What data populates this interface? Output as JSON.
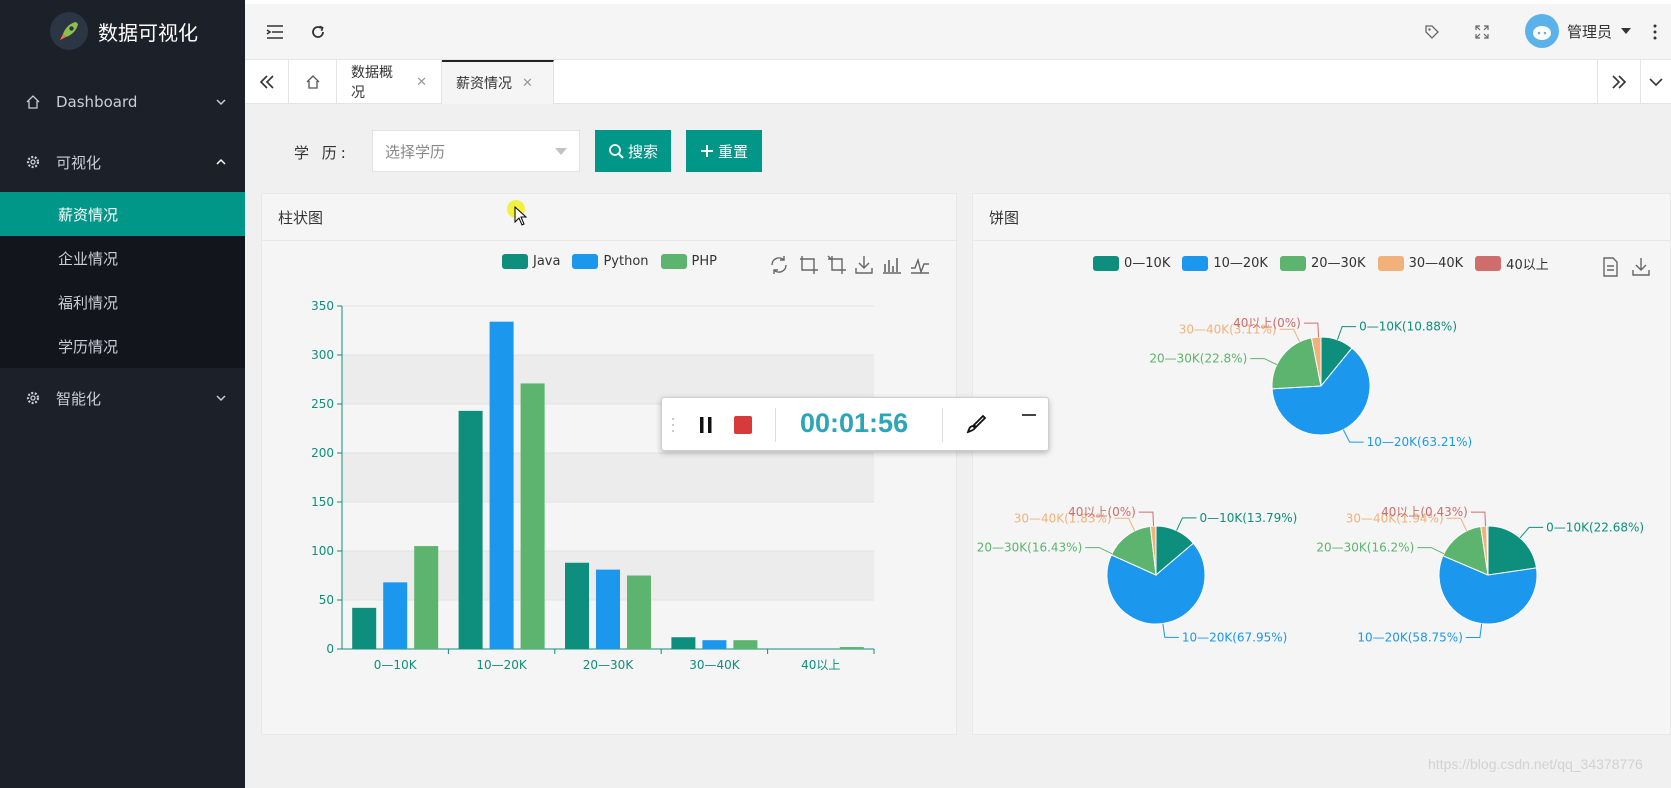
{
  "app": {
    "title": "数据可视化",
    "user": "管理员",
    "watermark": "https://blog.csdn.net/qq_34378776"
  },
  "sidebar": {
    "items": [
      {
        "label": "Dashboard",
        "icon": "home-icon"
      },
      {
        "label": "可视化",
        "icon": "gear-icon",
        "expanded": true,
        "children": [
          "薪资情况",
          "企业情况",
          "福利情况",
          "学历情况"
        ],
        "active_child": "薪资情况"
      },
      {
        "label": "智能化",
        "icon": "gear-icon"
      }
    ]
  },
  "tabs": [
    {
      "label": "数据概况",
      "active": false
    },
    {
      "label": "薪资情况",
      "active": true
    }
  ],
  "search": {
    "label": "学 历:",
    "placeholder": "选择学历",
    "search_btn": "搜索",
    "reset_btn": "重置"
  },
  "bar_card": {
    "title": "柱状图"
  },
  "pie_card": {
    "title": "饼图"
  },
  "recorder": {
    "time": "00:01:56"
  },
  "colors": {
    "accent": "#009688",
    "java": "#0e8e7c",
    "python": "#1b97ee",
    "php": "#5cb46e",
    "c30_40": "#f0b27a",
    "c40": "#cf6d6d"
  },
  "chart_data": [
    {
      "type": "bar",
      "title": "柱状图",
      "categories": [
        "0—10K",
        "10—20K",
        "20—30K",
        "30—40K",
        "40以上"
      ],
      "series": [
        {
          "name": "Java",
          "values": [
            42,
            243,
            88,
            12,
            0
          ]
        },
        {
          "name": "Python",
          "values": [
            68,
            334,
            81,
            9,
            0
          ]
        },
        {
          "name": "PHP",
          "values": [
            105,
            271,
            75,
            9,
            2
          ]
        }
      ],
      "ylim": [
        0,
        350
      ],
      "yticks": [
        0,
        50,
        100,
        150,
        200,
        250,
        300,
        350
      ],
      "legend": "top"
    },
    {
      "type": "pie",
      "title": "饼图",
      "legend_labels": [
        "0—10K",
        "10—20K",
        "20—30K",
        "30—40K",
        "40以上"
      ],
      "pies": [
        {
          "values": [
            10.88,
            63.21,
            22.8,
            3.11,
            0
          ],
          "labels": [
            "0—10K(10.88%)",
            "10—20K(63.21%)",
            "20—30K(22.8%)",
            "30—40K(3.11%)",
            "40以上(0%)"
          ]
        },
        {
          "values": [
            13.79,
            67.95,
            16.43,
            1.83,
            0
          ],
          "labels": [
            "0—10K(13.79%)",
            "10—20K(67.95%)",
            "20—30K(16.43%)",
            "30—40K(1.83%)",
            "40以上(0%)"
          ]
        },
        {
          "values": [
            22.68,
            58.75,
            16.2,
            1.94,
            0.43
          ],
          "labels": [
            "0—10K(22.68%)",
            "10—20K(58.75%)",
            "20—30K(16.2%)",
            "30—40K(1.94%)",
            "40以上(0.43%)"
          ]
        }
      ]
    }
  ]
}
